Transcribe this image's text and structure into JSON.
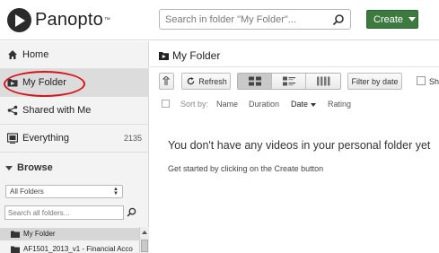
{
  "brand": {
    "name": "Panopto",
    "tm": "™"
  },
  "header": {
    "search_placeholder": "Search in folder \"My Folder\"...",
    "create_label": "Create"
  },
  "sidebar": {
    "nav": [
      {
        "label": "Home",
        "icon": "home-icon"
      },
      {
        "label": "My Folder",
        "icon": "folder-icon"
      },
      {
        "label": "Shared with Me",
        "icon": "share-icon"
      },
      {
        "label": "Everything",
        "icon": "everything-icon",
        "count": "2135"
      }
    ],
    "browse_title": "Browse",
    "folder_select_value": "All Folders",
    "folder_search_placeholder": "Search all folders...",
    "folders": [
      {
        "label": "My Folder"
      },
      {
        "label": "AF1501_2013_v1 - Financial Acco"
      }
    ]
  },
  "main": {
    "title": "My Folder",
    "refresh_label": "Refresh",
    "filter_label": "Filter by date",
    "show_label": "Sh",
    "sort_by_label": "Sort by:",
    "sort_options": [
      "Name",
      "Duration",
      "Date",
      "Rating"
    ],
    "active_sort": "Date",
    "empty_title": "You don't have any videos in your personal folder yet",
    "empty_subtitle": "Get started by clicking on the Create button"
  },
  "colors": {
    "create_button": "#3d7a40",
    "highlight": "#d5161a",
    "sidebar_bg": "#f3f3f3"
  }
}
